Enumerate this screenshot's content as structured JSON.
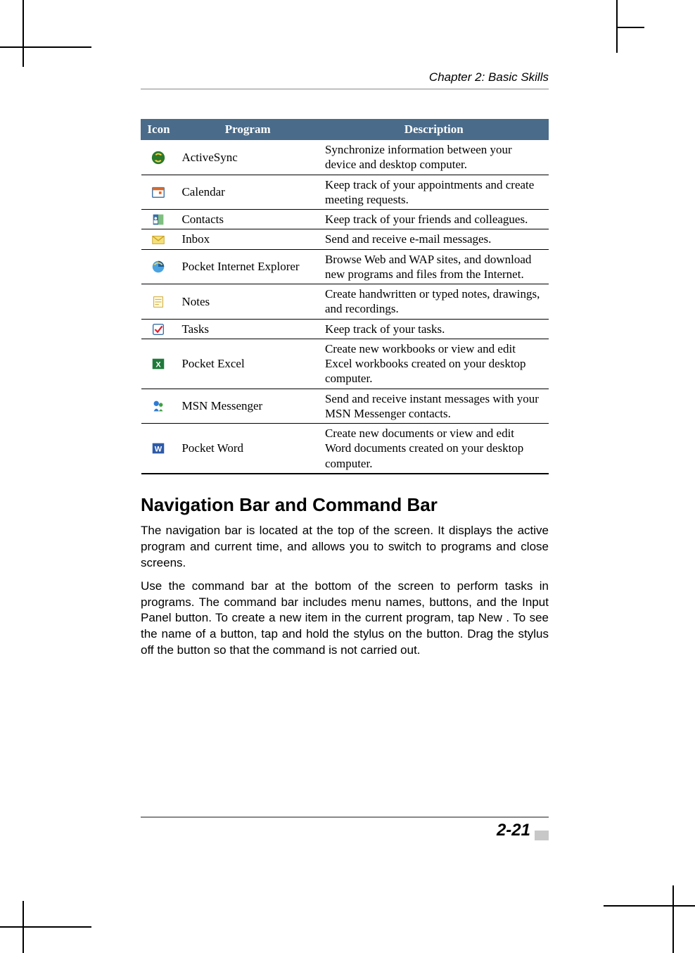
{
  "header": {
    "chapter": "Chapter 2: Basic Skills"
  },
  "table": {
    "headers": {
      "icon": "Icon",
      "program": "Program",
      "description": "Description"
    },
    "rows": [
      {
        "icon": "activesync-icon",
        "program": "ActiveSync",
        "description": "Synchronize information between your device and desktop computer."
      },
      {
        "icon": "calendar-icon",
        "program": "Calendar",
        "description": "Keep track of your appointments and create meeting requests."
      },
      {
        "icon": "contacts-icon",
        "program": "Contacts",
        "description": "Keep track of your friends and colleagues."
      },
      {
        "icon": "inbox-icon",
        "program": "Inbox",
        "description": "Send and receive e-mail messages."
      },
      {
        "icon": "pie-icon",
        "program": "Pocket Internet Explorer",
        "description": "Browse Web and WAP sites, and download new programs and files from the Internet."
      },
      {
        "icon": "notes-icon",
        "program": "Notes",
        "description": "Create handwritten or typed notes, drawings, and recordings."
      },
      {
        "icon": "tasks-icon",
        "program": "Tasks",
        "description": "Keep track of your tasks."
      },
      {
        "icon": "excel-icon",
        "program": "Pocket Excel",
        "description": "Create new workbooks or view and edit Excel workbooks created on your desktop computer."
      },
      {
        "icon": "msn-icon",
        "program": "MSN Messenger",
        "description": "Send and receive instant messages with your MSN Messenger contacts."
      },
      {
        "icon": "word-icon",
        "program": "Pocket Word",
        "description": "Create new documents or view and edit Word documents created on your desktop computer."
      }
    ]
  },
  "section": {
    "heading": "Navigation Bar and Command Bar",
    "para1": "The navigation bar is located at the top of the screen. It displays the active program and current time, and allows you to switch to programs and close screens.",
    "para2": "Use the command bar at the bottom of the screen to perform tasks in programs. The command bar includes menu names, buttons, and the Input Panel button. To create a new item in the current program, tap  New . To see the name of a button, tap and hold the stylus on the button. Drag the stylus off the button so that the command is not carried out."
  },
  "footer": {
    "page_number": "2-21"
  }
}
